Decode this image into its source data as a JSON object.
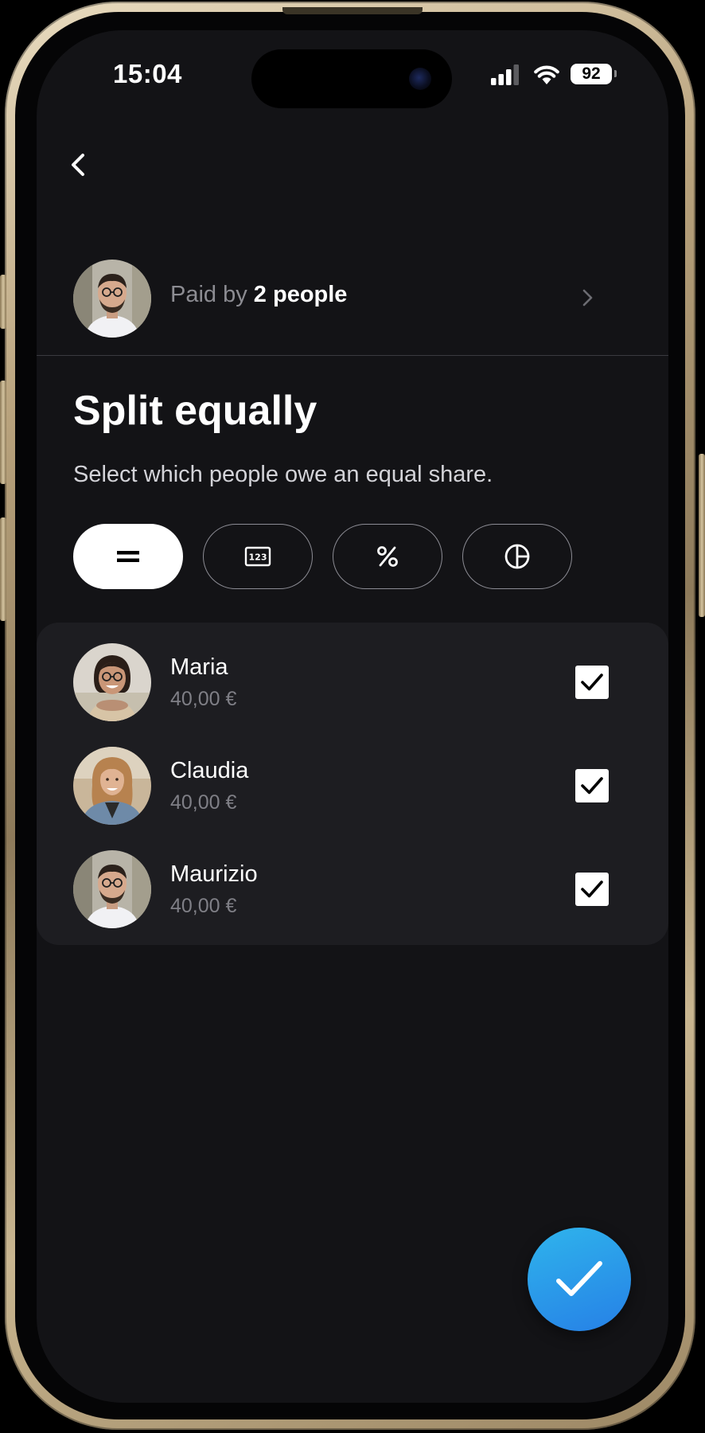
{
  "status_bar": {
    "time": "15:04",
    "battery": "92",
    "icons": [
      "cellular-signal-icon",
      "wifi-icon",
      "battery-icon"
    ]
  },
  "nav": {
    "back_icon": "chevron-left-icon"
  },
  "payer": {
    "prefix": "Paid by",
    "highlight": "2 people",
    "chevron_icon": "chevron-right-icon"
  },
  "split": {
    "title": "Split equally",
    "subtitle": "Select which people owe an equal share."
  },
  "modes": [
    {
      "name": "equal",
      "icon": "equals-icon",
      "active": true
    },
    {
      "name": "amount",
      "icon": "number-keypad-icon",
      "active": false
    },
    {
      "name": "percentage",
      "icon": "percent-icon",
      "active": false
    },
    {
      "name": "shares",
      "icon": "pie-chart-icon",
      "active": false
    }
  ],
  "people": [
    {
      "name": "Maria",
      "amount": "40,00 €",
      "checked": true
    },
    {
      "name": "Claudia",
      "amount": "40,00 €",
      "checked": true
    },
    {
      "name": "Maurizio",
      "amount": "40,00 €",
      "checked": true
    }
  ],
  "confirm": {
    "icon": "checkmark-icon"
  },
  "colors": {
    "background": "#131316",
    "card": "#1d1d21",
    "text_primary": "#ffffff",
    "text_secondary": "#8c8c92",
    "accent_gradient_start": "#2fb4ec",
    "accent_gradient_end": "#2680e6"
  }
}
